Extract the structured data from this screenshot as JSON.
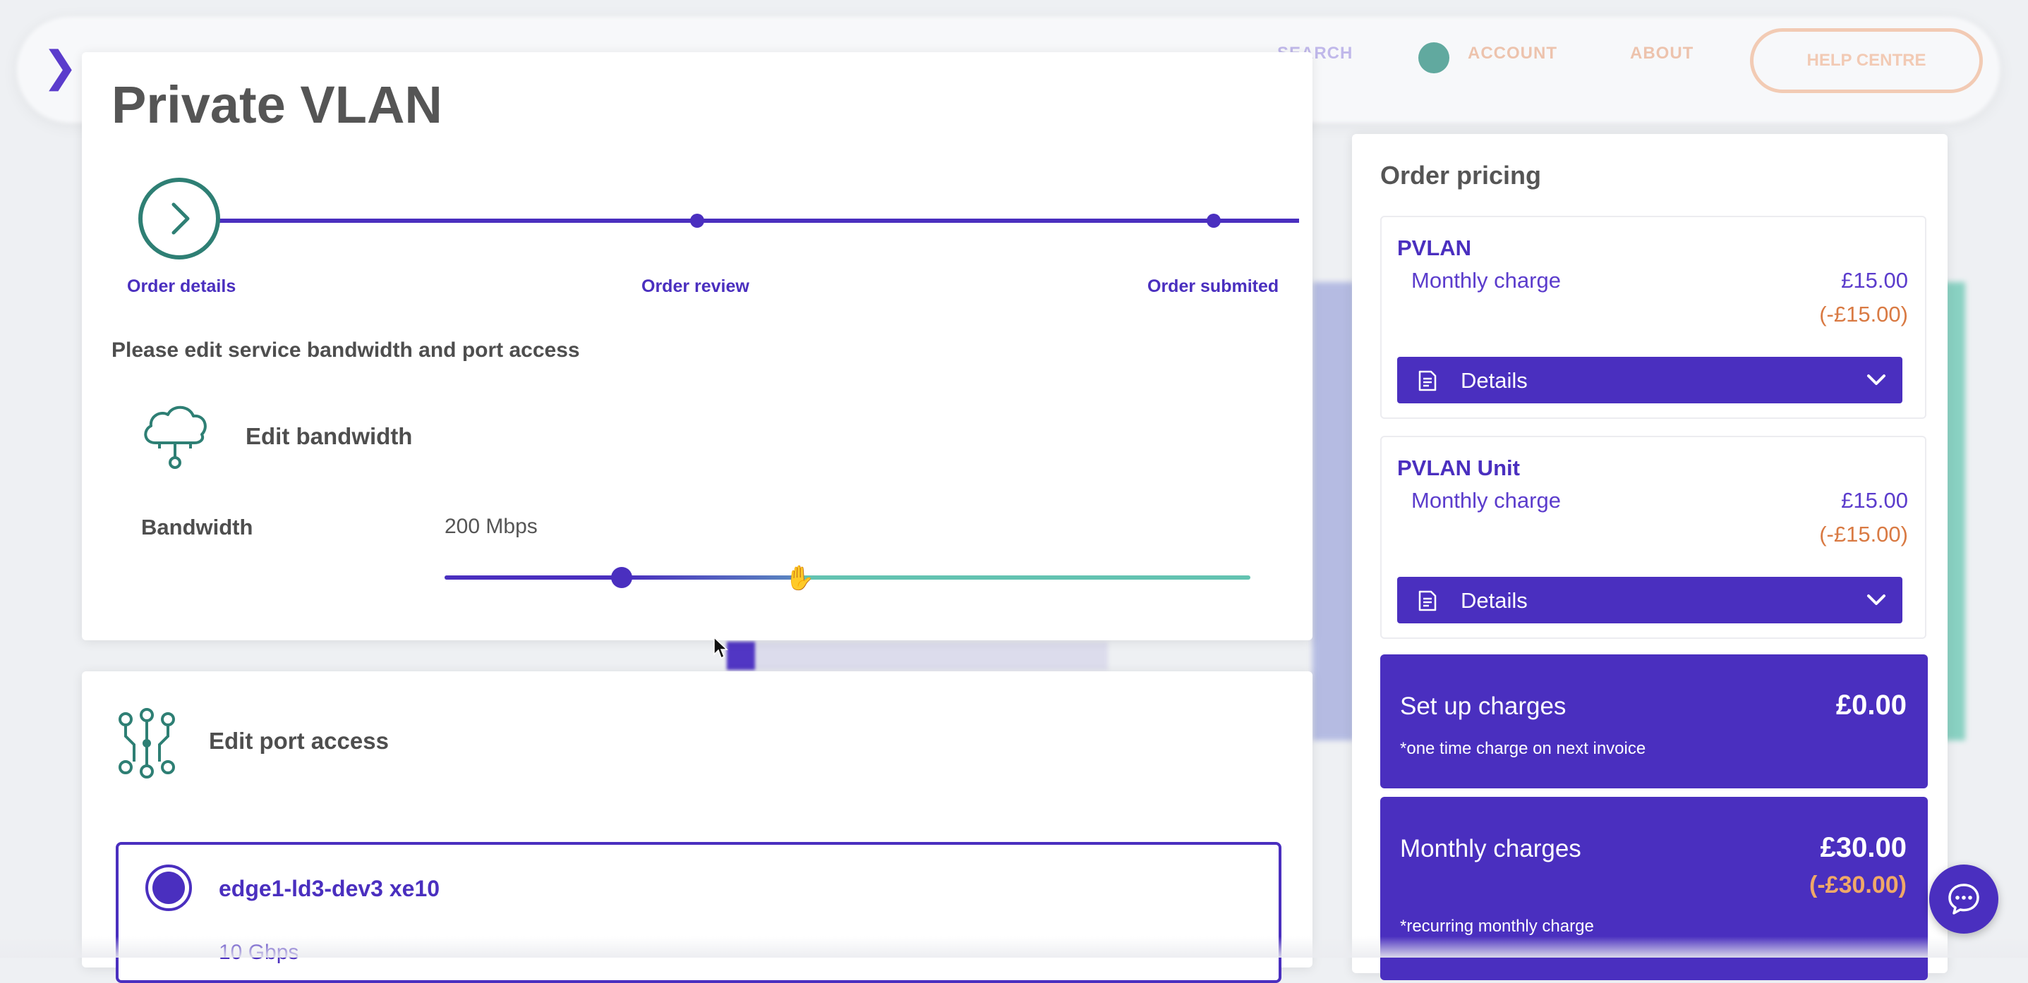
{
  "background": {
    "nav_search": "SEARCH",
    "nav_account": "ACCOUNT",
    "nav_about": "ABOUT",
    "nav_help": "HELP CENTRE"
  },
  "page": {
    "title": "Private VLAN",
    "steps": [
      {
        "label": "Order details",
        "state": "current"
      },
      {
        "label": "Order review",
        "state": "upcoming"
      },
      {
        "label": "Order submited",
        "state": "upcoming"
      }
    ],
    "instruction": "Please edit service bandwidth and port access"
  },
  "bandwidth": {
    "heading": "Edit bandwidth",
    "label": "Bandwidth",
    "value": "200 Mbps",
    "slider_fraction": 0.22
  },
  "port_access": {
    "heading": "Edit port access",
    "selected_port": {
      "name": "edge1-ld3-dev3 xe10",
      "speed": "10 Gbps"
    }
  },
  "pricing": {
    "title": "Order pricing",
    "items": [
      {
        "name": "PVLAN",
        "charge_label": "Monthly charge",
        "price": "£15.00",
        "discount": "(-£15.00)",
        "details_label": "Details"
      },
      {
        "name": "PVLAN Unit",
        "charge_label": "Monthly charge",
        "price": "£15.00",
        "discount": "(-£15.00)",
        "details_label": "Details"
      }
    ],
    "setup": {
      "label": "Set up charges",
      "value": "£0.00",
      "note": "*one time charge on next invoice"
    },
    "monthly": {
      "label": "Monthly charges",
      "value": "£30.00",
      "discount": "(-£30.00)",
      "note": "*recurring monthly charge"
    }
  },
  "colors": {
    "primary": "#4a2fbf",
    "teal": "#2e7f74",
    "slider_rest": "#63c3b1",
    "discount": "#d97a43"
  },
  "icons": {
    "step_current": "chevron-right-icon",
    "bandwidth": "cloud-network-icon",
    "port": "network-nodes-icon",
    "details": "document-icon",
    "expand": "chevron-down-icon",
    "chat": "chat-bubble-icon"
  }
}
